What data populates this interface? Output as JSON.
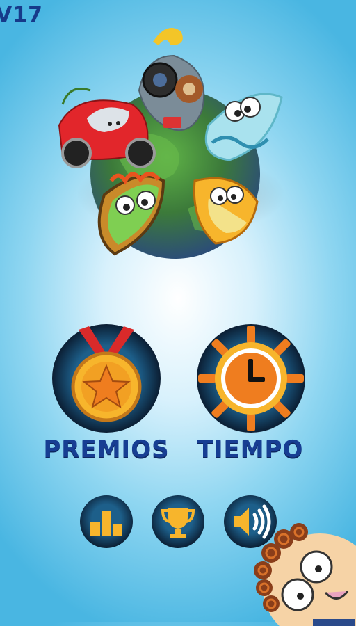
{
  "header": {
    "version": "V17"
  },
  "menu": {
    "prizes_label": "PREMIOS",
    "time_label": "TIEMPO"
  },
  "icons": {
    "prizes": "medal-star-icon",
    "time": "clock-sun-icon",
    "ranking": "podium-icon",
    "trophy": "trophy-icon",
    "sound": "speaker-icon"
  },
  "colors": {
    "label": "#173e93",
    "button_ring": "#0e2440",
    "gold": "#f7b52c",
    "orange": "#ef7d1f"
  }
}
